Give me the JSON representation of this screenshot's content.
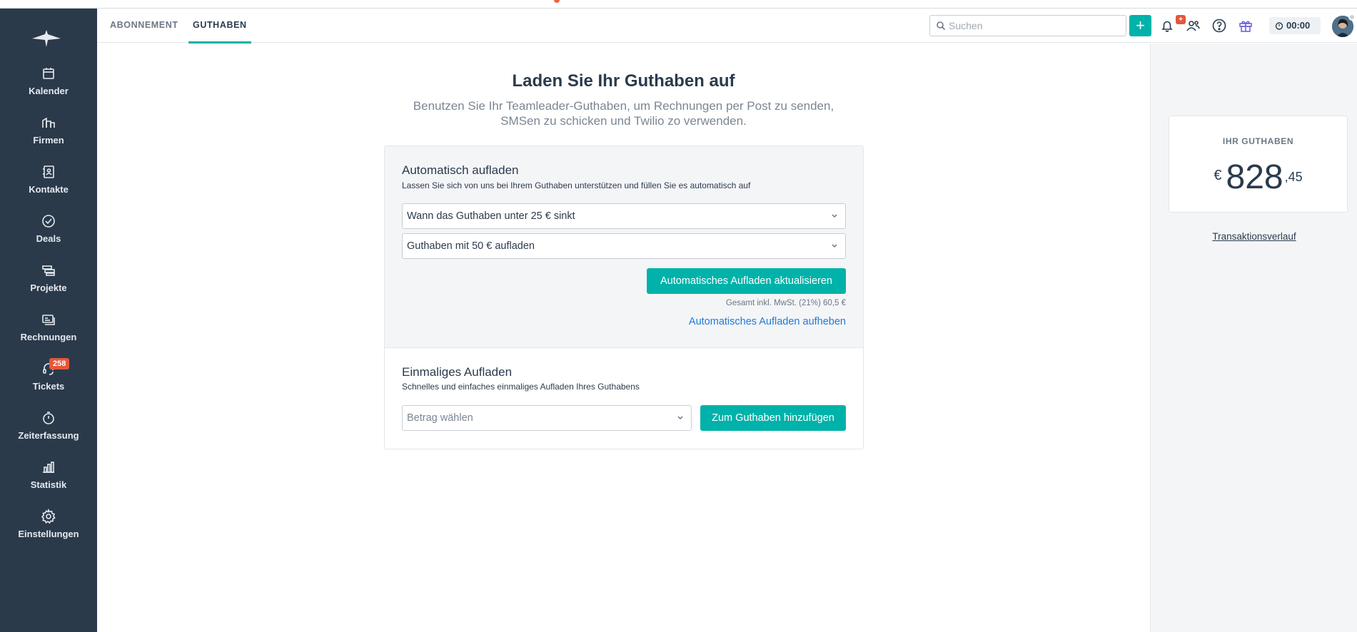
{
  "sidebar": {
    "items": [
      {
        "label": "Kalender",
        "icon": "calendar-icon"
      },
      {
        "label": "Firmen",
        "icon": "buildings-icon"
      },
      {
        "label": "Kontakte",
        "icon": "contacts-icon"
      },
      {
        "label": "Deals",
        "icon": "check-circle-icon"
      },
      {
        "label": "Projekte",
        "icon": "projects-icon"
      },
      {
        "label": "Rechnungen",
        "icon": "invoice-icon"
      },
      {
        "label": "Tickets",
        "icon": "headset-icon",
        "badge": "258"
      },
      {
        "label": "Zeiterfassung",
        "icon": "stopwatch-icon"
      },
      {
        "label": "Statistik",
        "icon": "bar-chart-icon"
      },
      {
        "label": "Einstellungen",
        "icon": "gear-icon"
      }
    ]
  },
  "header": {
    "tabs": [
      {
        "label": "ABONNEMENT",
        "active": false
      },
      {
        "label": "GUTHABEN",
        "active": true
      }
    ],
    "search_placeholder": "Suchen",
    "add_label": "+",
    "notification_badge": "+",
    "timer": "00:00"
  },
  "main": {
    "title": "Laden Sie Ihr Guthaben auf",
    "subtitle": "Benutzen Sie Ihr Teamleader-Guthaben, um Rechnungen per Post zu senden, SMSen zu schicken und Twilio zo verwenden.",
    "auto": {
      "title": "Automatisch aufladen",
      "description": "Lassen Sie sich von uns bei Ihrem Guthaben unterstützen und füllen Sie es automatisch auf",
      "threshold_select": "Wann das Guthaben unter 25 € sinkt",
      "amount_select": "Guthaben mit 50 € aufladen",
      "update_button": "Automatisches Aufladen aktualisieren",
      "total": "Gesamt inkl. MwSt. (21%) 60,5 €",
      "cancel_link": "Automatisches Aufladen aufheben"
    },
    "once": {
      "title": "Einmaliges Aufladen",
      "description": "Schnelles und einfaches einmaliges Aufladen Ihres Guthabens",
      "amount_placeholder": "Betrag wählen",
      "add_button": "Zum Guthaben hinzufügen"
    }
  },
  "balance": {
    "title": "IHR GUTHABEN",
    "currency": "€",
    "amount_main": "828",
    "amount_cents": ",45",
    "history_link": "Transaktionsverlauf"
  },
  "colors": {
    "sidebar_bg": "#2b3a4a",
    "accent": "#00b2a9",
    "badge": "#e5573a",
    "link": "#1f7ad9"
  }
}
